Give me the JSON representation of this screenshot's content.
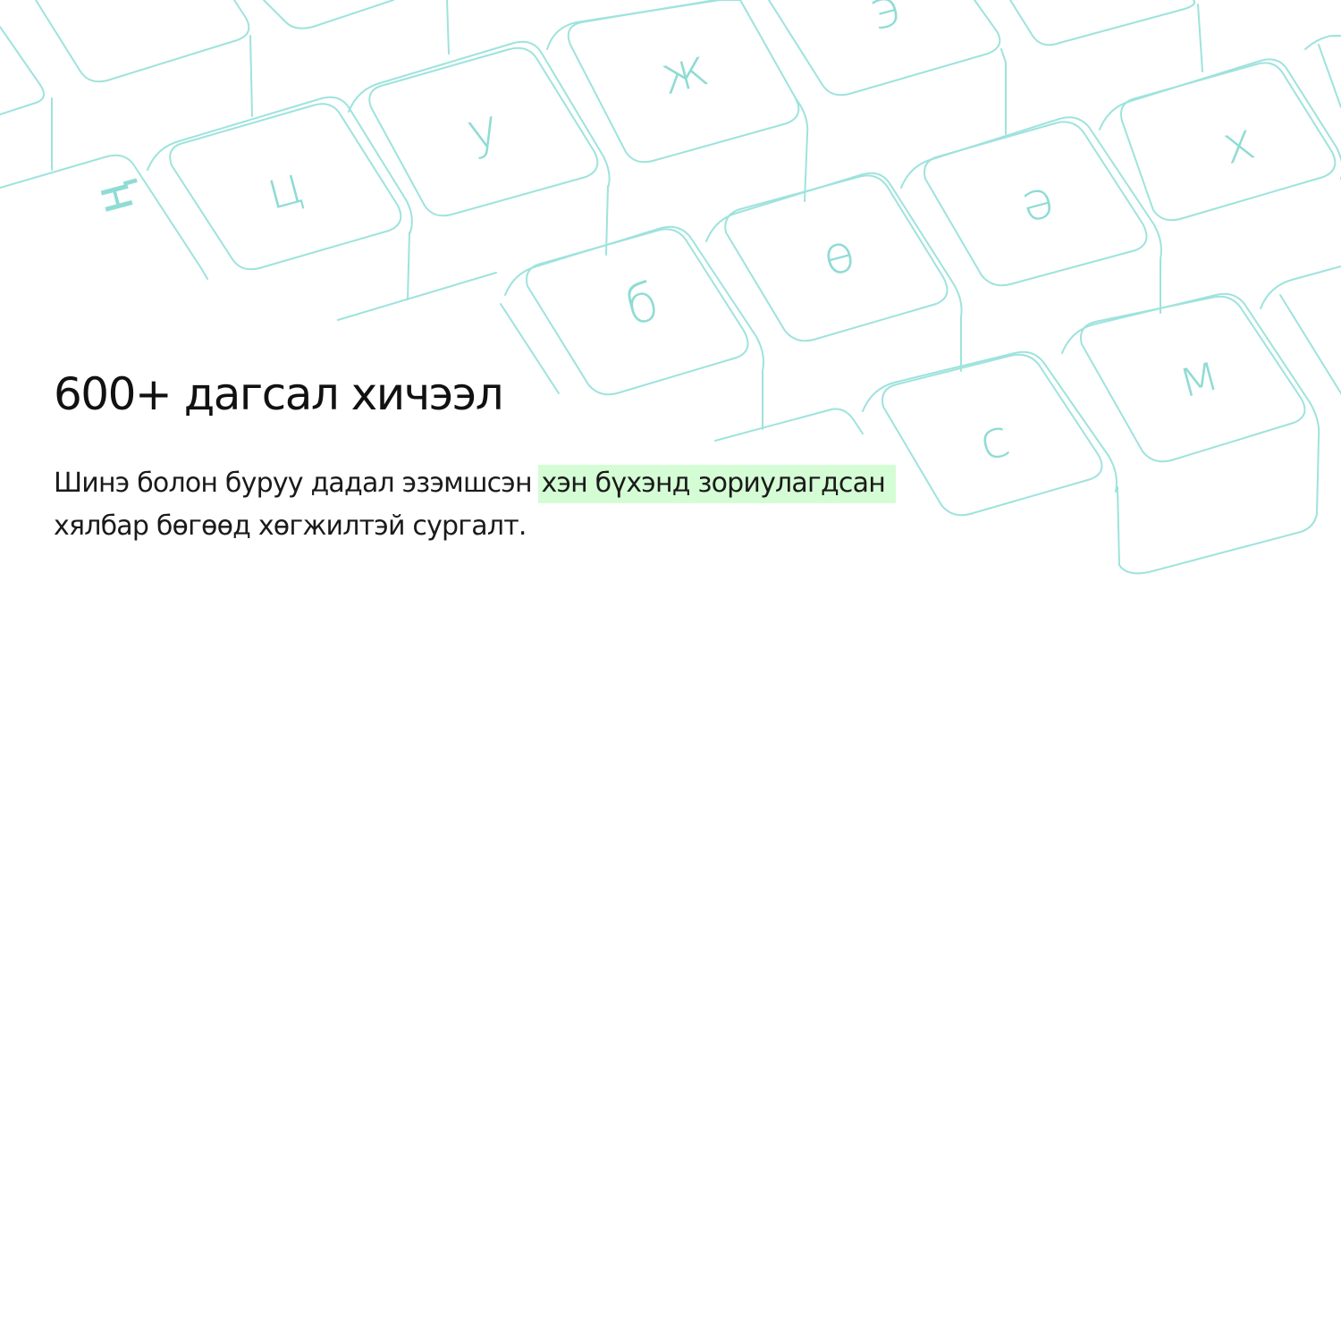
{
  "illustration": {
    "keys": [
      "ң",
      "ц",
      "у",
      "ж",
      "э",
      "ө",
      "ә",
      "х",
      "б",
      "с",
      "м"
    ],
    "stroke_color": "#9ee3dd",
    "glyph_color": "#8fdcd4"
  },
  "headline": "600+ дагсал хичээл",
  "description": {
    "line1_start": "Шинэ болон буруу дадал эзэмшсэн ",
    "line1_highlight": "хэн бүхэнд зориулагдсан",
    "line2": "хялбар бөгөөд хөгжилтэй сургалт.",
    "highlight_color": "#d5fdd5"
  }
}
